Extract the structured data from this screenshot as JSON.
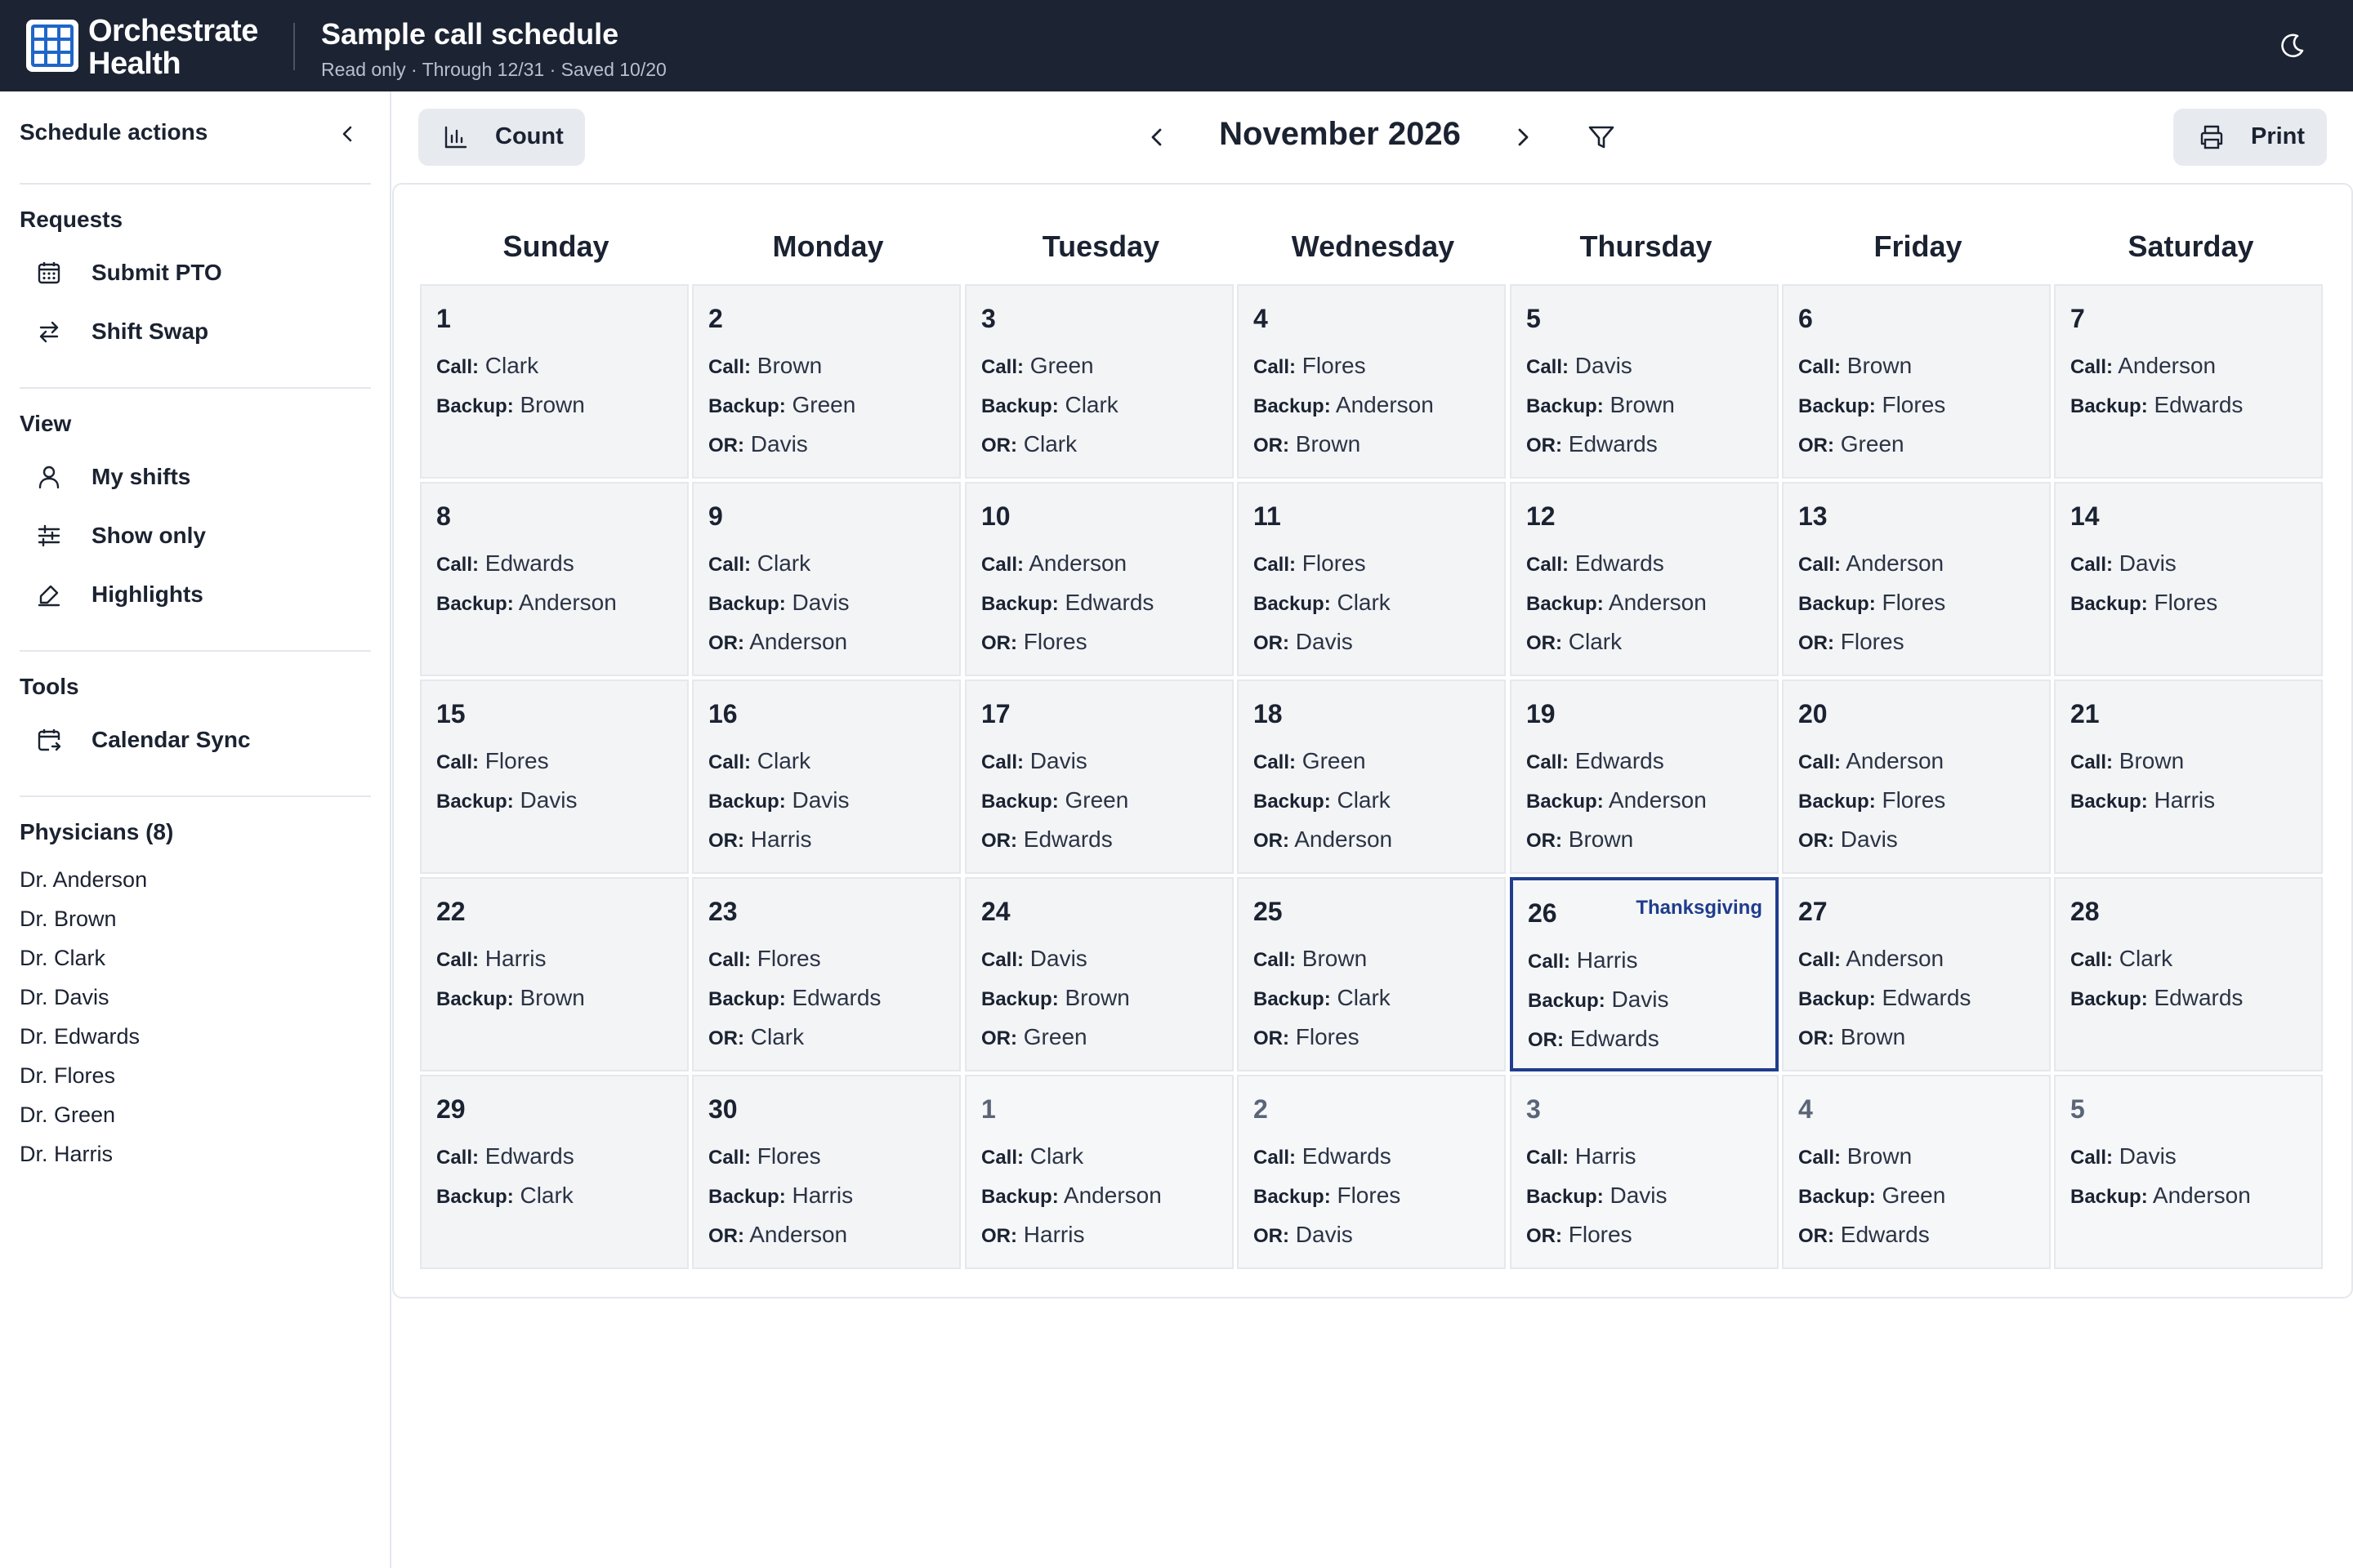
{
  "header": {
    "brand_line1": "Orchestrate",
    "brand_line2": "Health",
    "title": "Sample call schedule",
    "subtitle": "Read only · Through 12/31 · Saved 10/20",
    "theme_icon": "moon-icon"
  },
  "sidebar": {
    "title": "Schedule actions",
    "sections": {
      "requests": {
        "title": "Requests",
        "items": [
          {
            "label": "Submit PTO",
            "icon": "calendar-icon"
          },
          {
            "label": "Shift Swap",
            "icon": "swap-arrows-icon"
          }
        ]
      },
      "view": {
        "title": "View",
        "items": [
          {
            "label": "My shifts",
            "icon": "person-icon"
          },
          {
            "label": "Show only",
            "icon": "sliders-icon"
          },
          {
            "label": "Highlights",
            "icon": "highlighter-icon"
          }
        ]
      },
      "tools": {
        "title": "Tools",
        "items": [
          {
            "label": "Calendar Sync",
            "icon": "calendar-sync-icon"
          }
        ]
      },
      "physicians": {
        "title": "Physicians (8)",
        "items": [
          "Dr. Anderson",
          "Dr. Brown",
          "Dr. Clark",
          "Dr. Davis",
          "Dr. Edwards",
          "Dr. Flores",
          "Dr. Green",
          "Dr. Harris"
        ]
      }
    }
  },
  "toolbar": {
    "count_label": "Count",
    "month_label": "November 2026",
    "print_label": "Print"
  },
  "calendar": {
    "weekdays": [
      "Sunday",
      "Monday",
      "Tuesday",
      "Wednesday",
      "Thursday",
      "Friday",
      "Saturday"
    ],
    "labels": {
      "call": "Call:",
      "backup": "Backup:",
      "or": "OR:"
    },
    "accent": "#1f3d8c",
    "days": [
      {
        "d": "1",
        "call": "Clark",
        "backup": "Brown"
      },
      {
        "d": "2",
        "call": "Brown",
        "backup": "Green",
        "or": "Davis"
      },
      {
        "d": "3",
        "call": "Green",
        "backup": "Clark",
        "or": "Clark"
      },
      {
        "d": "4",
        "call": "Flores",
        "backup": "Anderson",
        "or": "Brown"
      },
      {
        "d": "5",
        "call": "Davis",
        "backup": "Brown",
        "or": "Edwards"
      },
      {
        "d": "6",
        "call": "Brown",
        "backup": "Flores",
        "or": "Green"
      },
      {
        "d": "7",
        "call": "Anderson",
        "backup": "Edwards"
      },
      {
        "d": "8",
        "call": "Edwards",
        "backup": "Anderson"
      },
      {
        "d": "9",
        "call": "Clark",
        "backup": "Davis",
        "or": "Anderson"
      },
      {
        "d": "10",
        "call": "Anderson",
        "backup": "Edwards",
        "or": "Flores"
      },
      {
        "d": "11",
        "call": "Flores",
        "backup": "Clark",
        "or": "Davis"
      },
      {
        "d": "12",
        "call": "Edwards",
        "backup": "Anderson",
        "or": "Clark"
      },
      {
        "d": "13",
        "call": "Anderson",
        "backup": "Flores",
        "or": "Flores"
      },
      {
        "d": "14",
        "call": "Davis",
        "backup": "Flores"
      },
      {
        "d": "15",
        "call": "Flores",
        "backup": "Davis"
      },
      {
        "d": "16",
        "call": "Clark",
        "backup": "Davis",
        "or": "Harris"
      },
      {
        "d": "17",
        "call": "Davis",
        "backup": "Green",
        "or": "Edwards"
      },
      {
        "d": "18",
        "call": "Green",
        "backup": "Clark",
        "or": "Anderson"
      },
      {
        "d": "19",
        "call": "Edwards",
        "backup": "Anderson",
        "or": "Brown"
      },
      {
        "d": "20",
        "call": "Anderson",
        "backup": "Flores",
        "or": "Davis"
      },
      {
        "d": "21",
        "call": "Brown",
        "backup": "Harris"
      },
      {
        "d": "22",
        "call": "Harris",
        "backup": "Brown"
      },
      {
        "d": "23",
        "call": "Flores",
        "backup": "Edwards",
        "or": "Clark"
      },
      {
        "d": "24",
        "call": "Davis",
        "backup": "Brown",
        "or": "Green"
      },
      {
        "d": "25",
        "call": "Brown",
        "backup": "Clark",
        "or": "Flores"
      },
      {
        "d": "26",
        "call": "Harris",
        "backup": "Davis",
        "or": "Edwards",
        "holiday": "Thanksgiving",
        "today": true
      },
      {
        "d": "27",
        "call": "Anderson",
        "backup": "Edwards",
        "or": "Brown"
      },
      {
        "d": "28",
        "call": "Clark",
        "backup": "Edwards"
      },
      {
        "d": "29",
        "call": "Edwards",
        "backup": "Clark"
      },
      {
        "d": "30",
        "call": "Flores",
        "backup": "Harris",
        "or": "Anderson"
      },
      {
        "d": "1",
        "call": "Clark",
        "backup": "Anderson",
        "or": "Harris",
        "other": true
      },
      {
        "d": "2",
        "call": "Edwards",
        "backup": "Flores",
        "or": "Davis",
        "other": true
      },
      {
        "d": "3",
        "call": "Harris",
        "backup": "Davis",
        "or": "Flores",
        "other": true
      },
      {
        "d": "4",
        "call": "Brown",
        "backup": "Green",
        "or": "Edwards",
        "other": true
      },
      {
        "d": "5",
        "call": "Davis",
        "backup": "Anderson",
        "other": true
      }
    ]
  }
}
